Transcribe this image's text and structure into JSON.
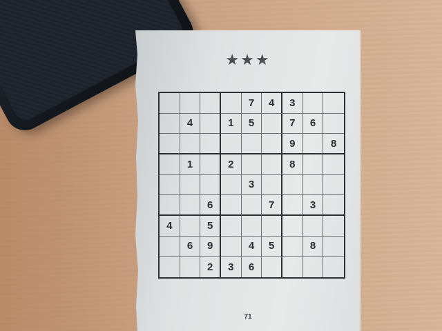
{
  "puzzle": {
    "difficulty_stars": "★★★",
    "page_number": "71",
    "grid": [
      [
        "",
        "",
        "",
        "",
        "7",
        "4",
        "3",
        "",
        ""
      ],
      [
        "",
        "4",
        "",
        "1",
        "5",
        "",
        "7",
        "6",
        ""
      ],
      [
        "",
        "",
        "",
        "",
        "",
        "",
        "9",
        "",
        "8"
      ],
      [
        "",
        "1",
        "",
        "2",
        "",
        "",
        "8",
        "",
        ""
      ],
      [
        "",
        "",
        "",
        "",
        "3",
        "",
        "",
        "",
        ""
      ],
      [
        "",
        "",
        "6",
        "",
        "",
        "7",
        "",
        "3",
        ""
      ],
      [
        "4",
        "",
        "5",
        "",
        "",
        "",
        "",
        "",
        ""
      ],
      [
        "",
        "6",
        "9",
        "",
        "4",
        "5",
        "",
        "8",
        ""
      ],
      [
        "",
        "",
        "2",
        "3",
        "6",
        "",
        "",
        "",
        ""
      ]
    ]
  }
}
